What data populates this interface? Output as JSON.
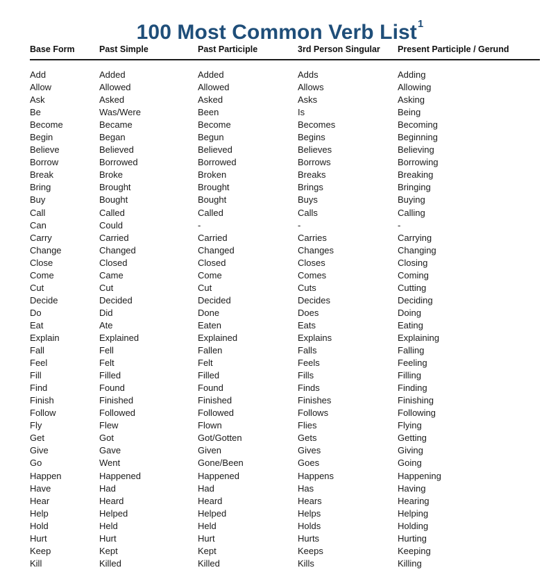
{
  "document": {
    "title": "100 Most Common Verb List",
    "footnote_marker": "1",
    "title_color": "#1f4e79",
    "text_color": "#1a1a1a",
    "background_color": "#ffffff"
  },
  "table": {
    "headers": [
      "Base Form",
      "Past Simple",
      "Past Participle",
      "3rd Person Singular",
      "Present Participle / Gerund"
    ],
    "rows": [
      [
        "Add",
        "Added",
        "Added",
        "Adds",
        "Adding"
      ],
      [
        "Allow",
        "Allowed",
        "Allowed",
        "Allows",
        "Allowing"
      ],
      [
        "Ask",
        "Asked",
        "Asked",
        "Asks",
        "Asking"
      ],
      [
        "Be",
        "Was/Were",
        "Been",
        "Is",
        "Being"
      ],
      [
        "Become",
        "Became",
        "Become",
        "Becomes",
        "Becoming"
      ],
      [
        "Begin",
        "Began",
        "Begun",
        "Begins",
        "Beginning"
      ],
      [
        "Believe",
        "Believed",
        "Believed",
        "Believes",
        "Believing"
      ],
      [
        "Borrow",
        "Borrowed",
        "Borrowed",
        "Borrows",
        "Borrowing"
      ],
      [
        "Break",
        "Broke",
        "Broken",
        "Breaks",
        "Breaking"
      ],
      [
        "Bring",
        "Brought",
        "Brought",
        "Brings",
        "Bringing"
      ],
      [
        "Buy",
        "Bought",
        "Bought",
        "Buys",
        "Buying"
      ],
      [
        "Call",
        "Called",
        "Called",
        "Calls",
        "Calling"
      ],
      [
        "Can",
        "Could",
        "-",
        "-",
        "-"
      ],
      [
        "Carry",
        "Carried",
        "Carried",
        "Carries",
        "Carrying"
      ],
      [
        "Change",
        "Changed",
        "Changed",
        "Changes",
        "Changing"
      ],
      [
        "Close",
        "Closed",
        "Closed",
        "Closes",
        "Closing"
      ],
      [
        "Come",
        "Came",
        "Come",
        "Comes",
        "Coming"
      ],
      [
        "Cut",
        "Cut",
        "Cut",
        "Cuts",
        "Cutting"
      ],
      [
        "Decide",
        "Decided",
        "Decided",
        "Decides",
        "Deciding"
      ],
      [
        "Do",
        "Did",
        "Done",
        "Does",
        "Doing"
      ],
      [
        "Eat",
        "Ate",
        "Eaten",
        "Eats",
        "Eating"
      ],
      [
        "Explain",
        "Explained",
        "Explained",
        "Explains",
        "Explaining"
      ],
      [
        "Fall",
        "Fell",
        "Fallen",
        "Falls",
        "Falling"
      ],
      [
        "Feel",
        "Felt",
        "Felt",
        "Feels",
        "Feeling"
      ],
      [
        "Fill",
        "Filled",
        "Filled",
        "Fills",
        "Filling"
      ],
      [
        "Find",
        "Found",
        "Found",
        "Finds",
        "Finding"
      ],
      [
        "Finish",
        "Finished",
        "Finished",
        "Finishes",
        "Finishing"
      ],
      [
        "Follow",
        "Followed",
        "Followed",
        "Follows",
        "Following"
      ],
      [
        "Fly",
        "Flew",
        "Flown",
        "Flies",
        "Flying"
      ],
      [
        "Get",
        "Got",
        "Got/Gotten",
        "Gets",
        "Getting"
      ],
      [
        "Give",
        "Gave",
        "Given",
        "Gives",
        "Giving"
      ],
      [
        "Go",
        "Went",
        "Gone/Been",
        "Goes",
        "Going"
      ],
      [
        "Happen",
        "Happened",
        "Happened",
        "Happens",
        "Happening"
      ],
      [
        "Have",
        "Had",
        "Had",
        "Has",
        "Having"
      ],
      [
        "Hear",
        "Heard",
        "Heard",
        "Hears",
        "Hearing"
      ],
      [
        "Help",
        "Helped",
        "Helped",
        "Helps",
        "Helping"
      ],
      [
        "Hold",
        "Held",
        "Held",
        "Holds",
        "Holding"
      ],
      [
        "Hurt",
        "Hurt",
        "Hurt",
        "Hurts",
        "Hurting"
      ],
      [
        "Keep",
        "Kept",
        "Kept",
        "Keeps",
        "Keeping"
      ],
      [
        "Kill",
        "Killed",
        "Killed",
        "Kills",
        "Killing"
      ]
    ]
  }
}
